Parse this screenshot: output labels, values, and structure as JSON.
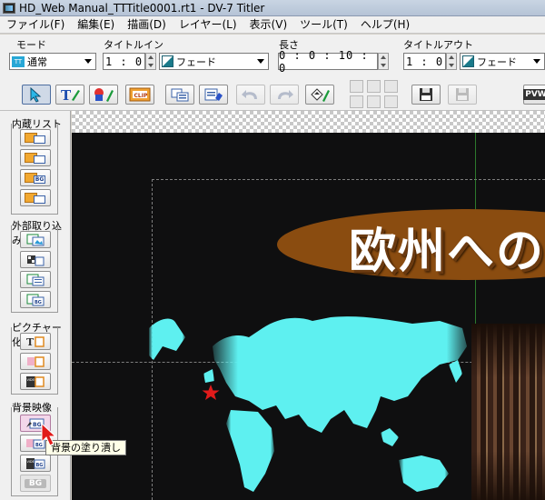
{
  "window": {
    "title": "HD_Web Manual_TTTitle0001.rt1 - DV-7 Titler"
  },
  "menu": [
    "ファイル(F)",
    "編集(E)",
    "描画(D)",
    "レイヤー(L)",
    "表示(V)",
    "ツール(T)",
    "ヘルプ(H)"
  ],
  "controls": {
    "mode_label": "モード",
    "mode_value": "通常",
    "mode_icon_text": "TT",
    "title_in_label": "タイトルイン",
    "title_in_time": "1 : 0",
    "title_in_effect": "フェード",
    "duration_label": "長さ",
    "duration_time": "0 : 0 : 10 : 0",
    "title_out_label": "タイトルアウト",
    "title_out_time": "1 : 0",
    "title_out_effect": "フェード"
  },
  "toolbar": {
    "clip_label": "CLIP",
    "pvw_label": "PVW"
  },
  "left_panel": {
    "groups": [
      {
        "title": "内蔵リスト",
        "buttons": 4
      },
      {
        "title": "外部取り込み",
        "buttons": 4
      },
      {
        "title": "ピクチャー化",
        "buttons": 3
      },
      {
        "title": "背景映像",
        "buttons": 4
      }
    ],
    "bg_tag": "BG",
    "video_tag": "VIDEO"
  },
  "canvas": {
    "title_text": "欧州への",
    "colors": {
      "ellipse": "#8a4c10",
      "map": "#5ef0f0",
      "star": "#e21b1b",
      "background": "#0f0f10"
    }
  },
  "tooltip": "背景の塗り潰し"
}
